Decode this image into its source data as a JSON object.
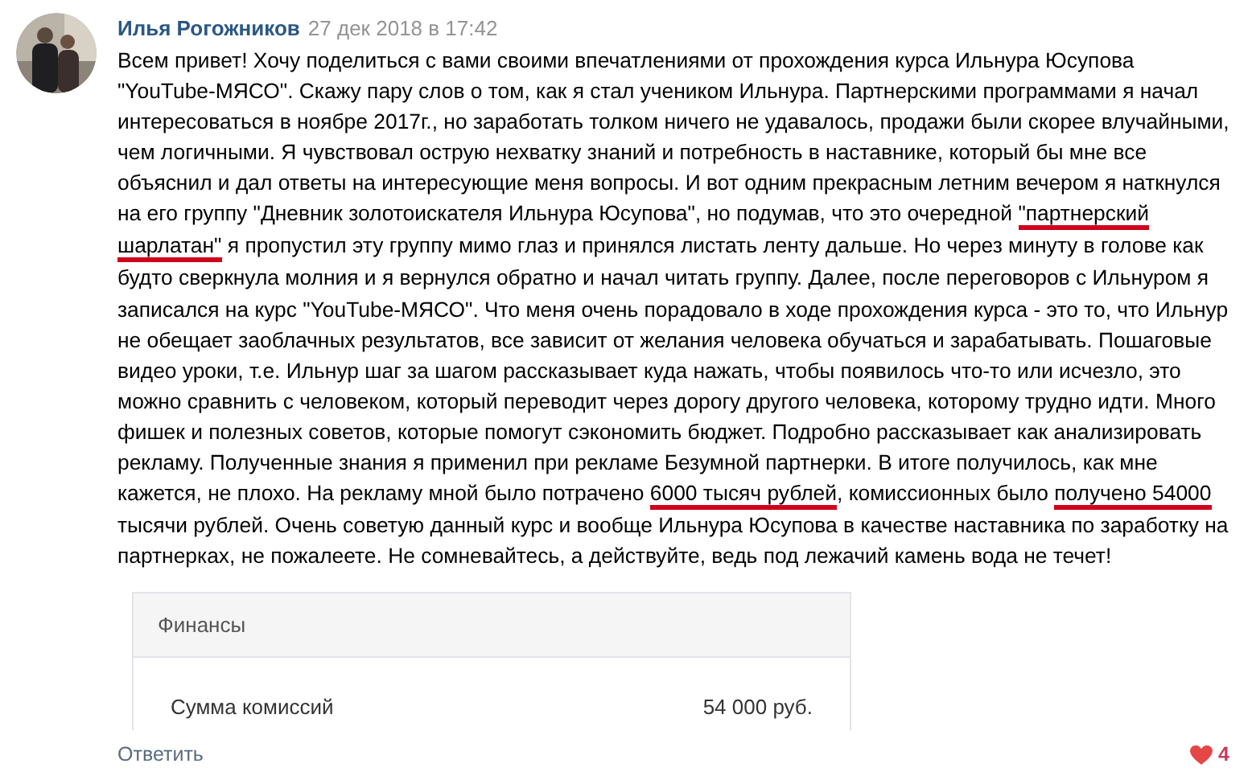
{
  "comment": {
    "author": "Илья Рогожников",
    "date": "27 дек 2018 в 17:42",
    "lines": [
      [
        {
          "text": "Всем привет! Хочу поделиться с вами своими впечатлениями от прохождения курса Ильнура Юсупова",
          "marked": false
        }
      ],
      [
        {
          "text": "\"YouTube-МЯСО\". Скажу пару слов о том, как я стал учеником Ильнура. Партнерскими программами я начал",
          "marked": false
        }
      ],
      [
        {
          "text": "интересоваться в ноябре 2017г., но заработать толком ничего не удавалось, продажи были скорее влучайными,",
          "marked": false
        }
      ],
      [
        {
          "text": "чем логичными. Я чувствовал острую нехватку знаний и потребность в наставнике, который бы мне все",
          "marked": false
        }
      ],
      [
        {
          "text": "объяснил и дал ответы на интересующие меня вопросы. И вот одним прекрасным летним вечером я наткнулся",
          "marked": false
        }
      ],
      [
        {
          "text": "на его группу \"Дневник золотоискателя Ильнура Юсупова\", но подумав, что это очередной ",
          "marked": false
        },
        {
          "text": "\"партнерский",
          "marked": true
        }
      ],
      [
        {
          "text": "шарлатан\"",
          "marked": true
        },
        {
          "text": " я пропустил эту группу мимо глаз и принялся листать ленту дальше. Но через минуту в голове как",
          "marked": false
        }
      ],
      [
        {
          "text": "будто сверкнула молния и я вернулся обратно и начал читать группу. Далее, после переговоров с Ильнуром я",
          "marked": false
        }
      ],
      [
        {
          "text": "записался на курс \"YouTube-МЯСО\". Что меня очень порадовало в ходе прохождения курса - это то, что Ильнур",
          "marked": false
        }
      ],
      [
        {
          "text": "не обещает заоблачных результатов, все зависит от желания человека обучаться и зарабатывать. Пошаговые",
          "marked": false
        }
      ],
      [
        {
          "text": "видео уроки, т.е. Ильнур шаг за шагом рассказывает куда нажать, чтобы появилось что-то или исчезло, это",
          "marked": false
        }
      ],
      [
        {
          "text": "можно сравнить с человеком, который переводит через дорогу другого человека, которому трудно идти. Много",
          "marked": false
        }
      ],
      [
        {
          "text": "фишек и полезных советов, которые помогут сэкономить бюджет. Подробно рассказывает как анализировать",
          "marked": false
        }
      ],
      [
        {
          "text": "рекламу. Полученные знания я применил при рекламе Безумной партнерки. В итоге получилось, как мне",
          "marked": false
        }
      ],
      [
        {
          "text": "кажется, не плохо. На рекламу мной было потрачено ",
          "marked": false
        },
        {
          "text": "6000 тысяч рублей",
          "marked": true
        },
        {
          "text": ", комиссионных было ",
          "marked": false
        },
        {
          "text": "получено 54000",
          "marked": true
        }
      ],
      [
        {
          "text": "тысячи рублей. Очень советую данный курс и вообще Ильнура Юсупова в качестве наставника по заработку на",
          "marked": false
        }
      ],
      [
        {
          "text": "партнерках, не пожалеете. Не сомневайтесь, а действуйте, ведь под лежачий камень вода не течет!",
          "marked": false
        }
      ]
    ],
    "attachment": {
      "header": "Финансы",
      "rows": [
        {
          "label": "Сумма комиссий",
          "value": "54 000 руб."
        }
      ]
    },
    "reply": "Ответить",
    "likes": {
      "count": "4",
      "liked": true
    }
  }
}
